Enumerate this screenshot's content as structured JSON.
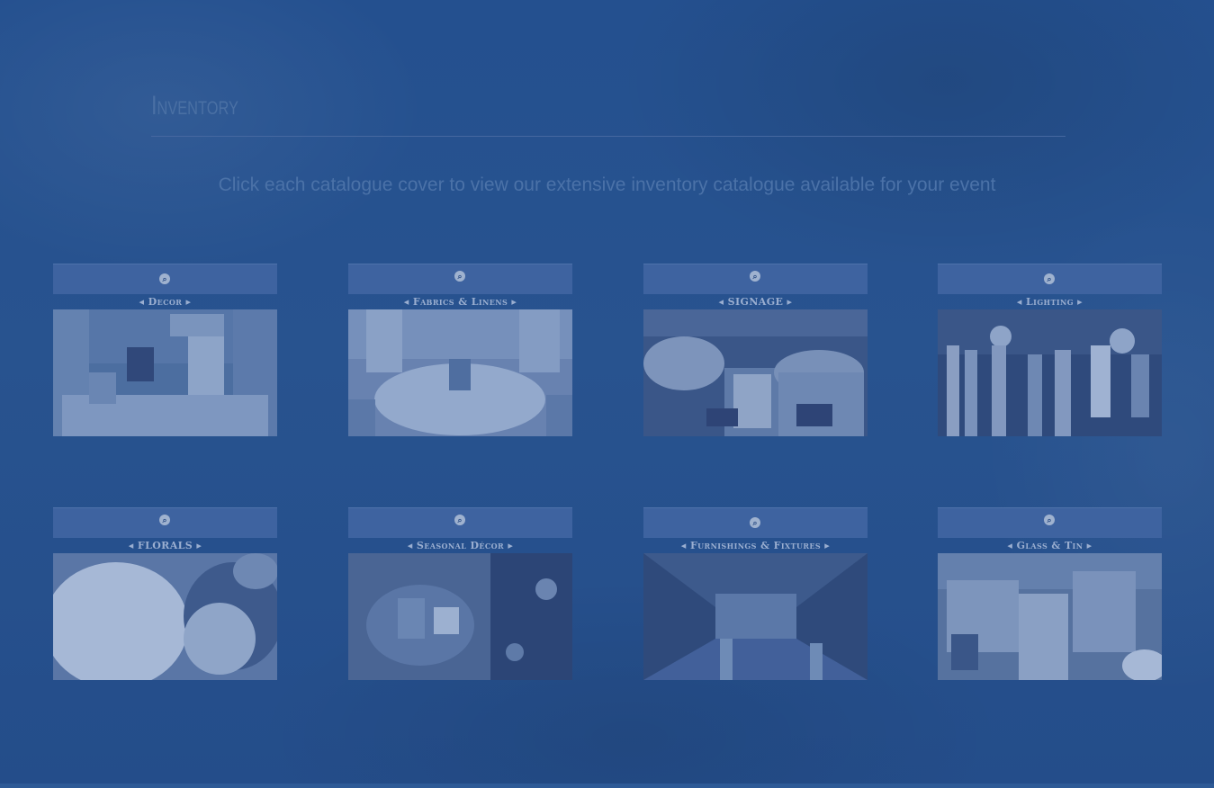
{
  "page": {
    "title": "Inventory",
    "subtitle": "Click each catalogue cover to view our extensive inventory catalogue available for your event"
  },
  "catalogues": [
    {
      "label": "◂ Decor ▸",
      "icon": "zoom-icon"
    },
    {
      "label": "◂ Fabrics & Linens ▸",
      "icon": "zoom-icon"
    },
    {
      "label": "◂ SIGNAGE ▸",
      "icon": "zoom-icon"
    },
    {
      "label": "◂ Lighting ▸",
      "icon": "zoom-icon"
    },
    {
      "label": "◂ FLORALS ▸",
      "icon": "zoom-icon"
    },
    {
      "label": "◂ Seasonal Décor ▸",
      "icon": "zoom-icon"
    },
    {
      "label": "◂ Furnishings & Fixtures ▸",
      "icon": "zoom-icon"
    },
    {
      "label": "◂ Glass & Tin ▸",
      "icon": "zoom-icon"
    }
  ],
  "colors": {
    "overlay": "#26508e",
    "card_header": "#3e63a0",
    "text_muted": "#4b72a8"
  }
}
